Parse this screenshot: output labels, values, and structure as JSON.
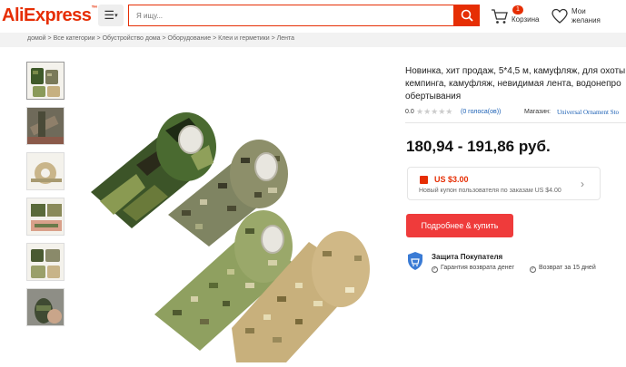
{
  "header": {
    "logo_text": "AliExpress",
    "menu_icon": "hamburger-icon",
    "search": {
      "placeholder": "Я ищу..."
    },
    "cart": {
      "count": "1",
      "label": "Корзина"
    },
    "wishlist": {
      "line1": "Мои",
      "line2": "желания"
    }
  },
  "breadcrumbs": [
    "домой",
    "Все категории",
    "Обустройство дома",
    "Оборудование",
    "Клеи и герметики",
    "Лента"
  ],
  "breadcrumb_separator": ">",
  "gallery": {
    "thumbnails": [
      "thumb-1",
      "thumb-2",
      "thumb-3",
      "thumb-4",
      "thumb-5",
      "thumb-6"
    ],
    "main_alt": "camouflage tape rolls"
  },
  "product": {
    "title_line1": "Новинка, хит продаж, 5*4,5 м, камуфляж, для охоты",
    "title_line2": "кемпинга, камуфляж, невидимая лента, водонепро",
    "title_line3": "обертывания",
    "rating": "0.0",
    "votes": "(0 голоса(ов))",
    "store_label": "Магазин:",
    "store_name": "Universal Ornament Sto",
    "price": "180,94 - 191,86 руб.",
    "coupon_title": "US $3.00",
    "coupon_sub": "Новый купон пользователя по заказам US $4.00",
    "buy_label": "Подробнее & купить",
    "protection_title": "Защита Покупателя",
    "protection_items": [
      "Гарантия возврата денег",
      "Возврат за 15 дней"
    ]
  },
  "colors": {
    "brand": "#e62e04",
    "buy_button": "#ef3b3b",
    "link": "#1a5fb4",
    "shield": "#3a7bd5"
  }
}
